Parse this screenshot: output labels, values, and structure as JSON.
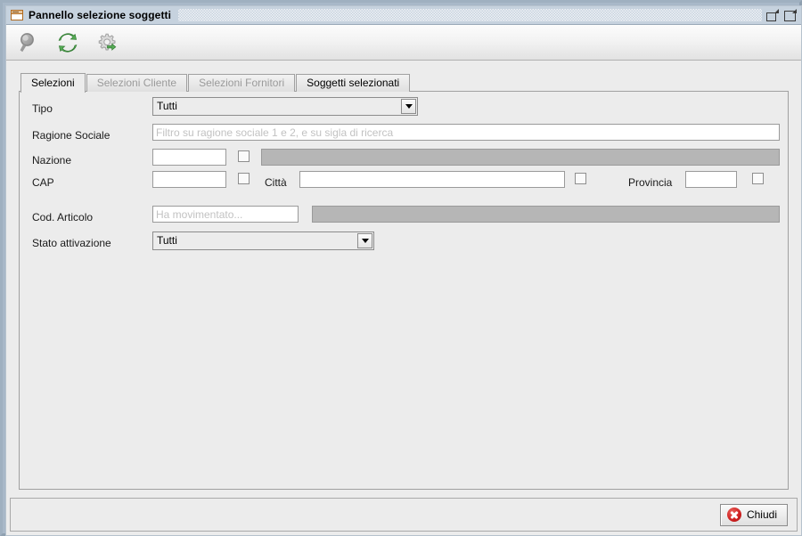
{
  "window": {
    "title": "Pannello selezione soggetti",
    "icon": "window-panel-icon",
    "restore_label": "",
    "maximize_label": ""
  },
  "toolbar": {
    "buttons": [
      {
        "name": "search-icon",
        "tooltip": "Cerca"
      },
      {
        "name": "refresh-icon",
        "tooltip": "Aggiorna"
      },
      {
        "name": "settings-run-icon",
        "tooltip": "Impostazioni"
      }
    ]
  },
  "tabs": [
    {
      "label": "Selezioni",
      "state": "active"
    },
    {
      "label": "Selezioni Cliente",
      "state": "disabled"
    },
    {
      "label": "Selezioni Fornitori",
      "state": "disabled"
    },
    {
      "label": "Soggetti selezionati",
      "state": "enabled"
    }
  ],
  "form": {
    "tipo": {
      "label": "Tipo",
      "value": "Tutti"
    },
    "ragione_sociale": {
      "label": "Ragione Sociale",
      "value": "",
      "placeholder": "Filtro su ragione sociale 1 e 2, e su sigla di ricerca"
    },
    "nazione": {
      "label": "Nazione",
      "value": "",
      "placeholder": ""
    },
    "cap": {
      "label": "CAP",
      "value": "",
      "placeholder": ""
    },
    "citta": {
      "label": "Città",
      "value": "",
      "placeholder": ""
    },
    "provincia": {
      "label": "Provincia",
      "value": "",
      "placeholder": ""
    },
    "cod_articolo": {
      "label": "Cod. Articolo",
      "value": "",
      "placeholder": "Ha movimentato..."
    },
    "stato_attivazione": {
      "label": "Stato attivazione",
      "value": "Tutti"
    }
  },
  "footer": {
    "close_label": "Chiudi",
    "close_icon": "close-circle-icon"
  },
  "colors": {
    "titlebar": "#c6d2de",
    "panel": "#ececec",
    "disabled_field": "#b6b6b6",
    "placeholder_text": "#c2c2c2",
    "disabled_tab_text": "#9a9a9a",
    "close_icon_red": "#cf1f1f",
    "toolbar_green": "#4fa14f",
    "title_icon_orange": "#b06a20"
  }
}
